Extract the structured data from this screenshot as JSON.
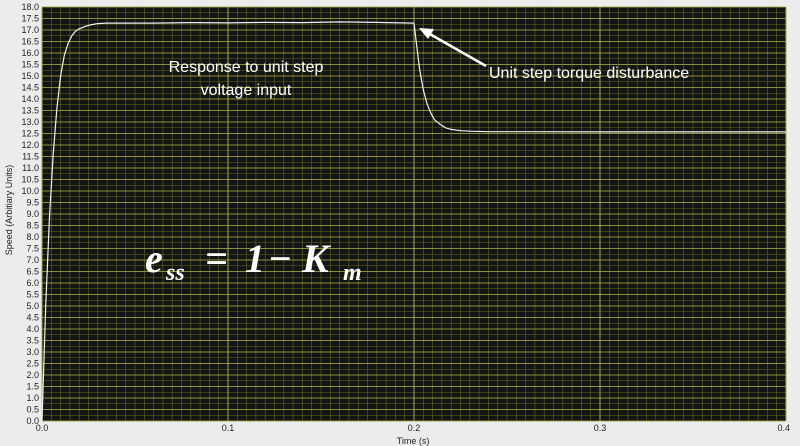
{
  "chart_data": {
    "type": "line",
    "title": "",
    "xlabel": "Time (s)",
    "ylabel": "Speed (Arbitiary Units)",
    "xlim": [
      0,
      0.4
    ],
    "ylim": [
      0,
      18
    ],
    "grid": true,
    "x_ticks": [
      "0.0",
      "0.1",
      "0.2",
      "0.3",
      "0.4"
    ],
    "y_ticks": [
      "0.0",
      "0.5",
      "1.0",
      "1.5",
      "2.0",
      "2.5",
      "3.0",
      "3.5",
      "4.0",
      "4.5",
      "5.0",
      "5.5",
      "6.0",
      "6.5",
      "7.0",
      "7.5",
      "8.0",
      "8.5",
      "9.0",
      "9.5",
      "10.0",
      "10.5",
      "11.0",
      "11.5",
      "12.0",
      "12.5",
      "13.0",
      "13.5",
      "14.0",
      "14.5",
      "15.0",
      "15.5",
      "16.0",
      "16.5",
      "17.0",
      "17.5",
      "18.0"
    ],
    "series": [
      {
        "color": "#f2f2f2",
        "x": [
          0,
          0.002,
          0.004,
          0.006,
          0.008,
          0.01,
          0.012,
          0.014,
          0.016,
          0.018,
          0.02,
          0.023,
          0.026,
          0.03,
          0.035,
          0.04,
          0.06,
          0.08,
          0.1,
          0.12,
          0.14,
          0.16,
          0.18,
          0.2,
          0.201,
          0.203,
          0.205,
          0.207,
          0.209,
          0.211,
          0.214,
          0.217,
          0.22,
          0.225,
          0.23,
          0.24,
          0.26,
          0.3,
          0.35,
          0.4
        ],
        "y": [
          0,
          5.0,
          8.8,
          11.6,
          13.6,
          15.0,
          15.9,
          16.4,
          16.75,
          16.95,
          17.05,
          17.15,
          17.22,
          17.28,
          17.3,
          17.3,
          17.3,
          17.32,
          17.31,
          17.33,
          17.32,
          17.35,
          17.33,
          17.3,
          16.6,
          15.3,
          14.4,
          13.8,
          13.4,
          13.1,
          12.9,
          12.75,
          12.68,
          12.62,
          12.6,
          12.58,
          12.58,
          12.57,
          12.57,
          12.57
        ]
      }
    ],
    "annotations": [
      {
        "text_lines": [
          "Response to unit step",
          "voltage input"
        ]
      },
      {
        "text": "Unit step torque disturbance",
        "arrow_to": [
          0.2,
          17.3
        ]
      }
    ],
    "formula": {
      "base_e": "e",
      "sub_ss": "ss",
      "equals": "=",
      "one": "1",
      "minus": "−",
      "base_k": "K",
      "sub_m": "m"
    }
  },
  "colors": {
    "plot_bg": "#141414",
    "minor_grid": "#5f6a1a",
    "major_grid": "#a8ab45",
    "curve": "#f2f2f2",
    "annotation": "#ffffff",
    "frame_bg": "#ececec"
  }
}
